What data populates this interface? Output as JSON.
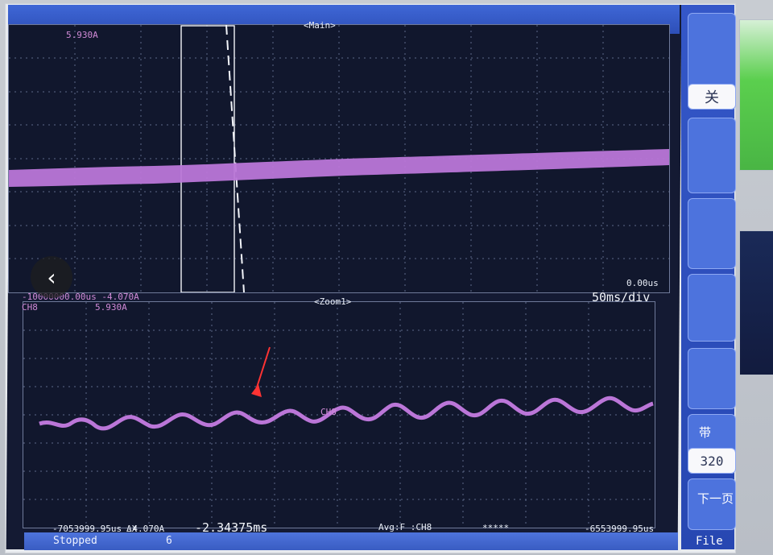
{
  "scope": {
    "main_label": "<Main>",
    "zoom_label": "<Zoom1>",
    "main_top_value": "5.930A",
    "main_bottom_left": "-10000000.00us -4.070A",
    "channel_tag_main": "CH8",
    "main_mid_value": "5.930A",
    "time_zero": "0.00us",
    "time_div": "50ms/div",
    "zoom_bottom_left": "-7053999.95us -4.070A",
    "zoom_bottom_right": "-6553999.95us",
    "delta_t_label": "ΔX",
    "delta_t_value": "-2.34375ms",
    "avg_label": "Avg:F :CH8",
    "stars": "*****",
    "zoom_channel_tag": "CH8"
  },
  "statusbar": {
    "state": "Stopped",
    "count": "6",
    "file_label": "File"
  },
  "menu": {
    "btn1": "关",
    "btn2": "带",
    "btn3": "320",
    "btn4": "下一页"
  },
  "icons": {
    "left_nav": "chevron-left-icon"
  }
}
